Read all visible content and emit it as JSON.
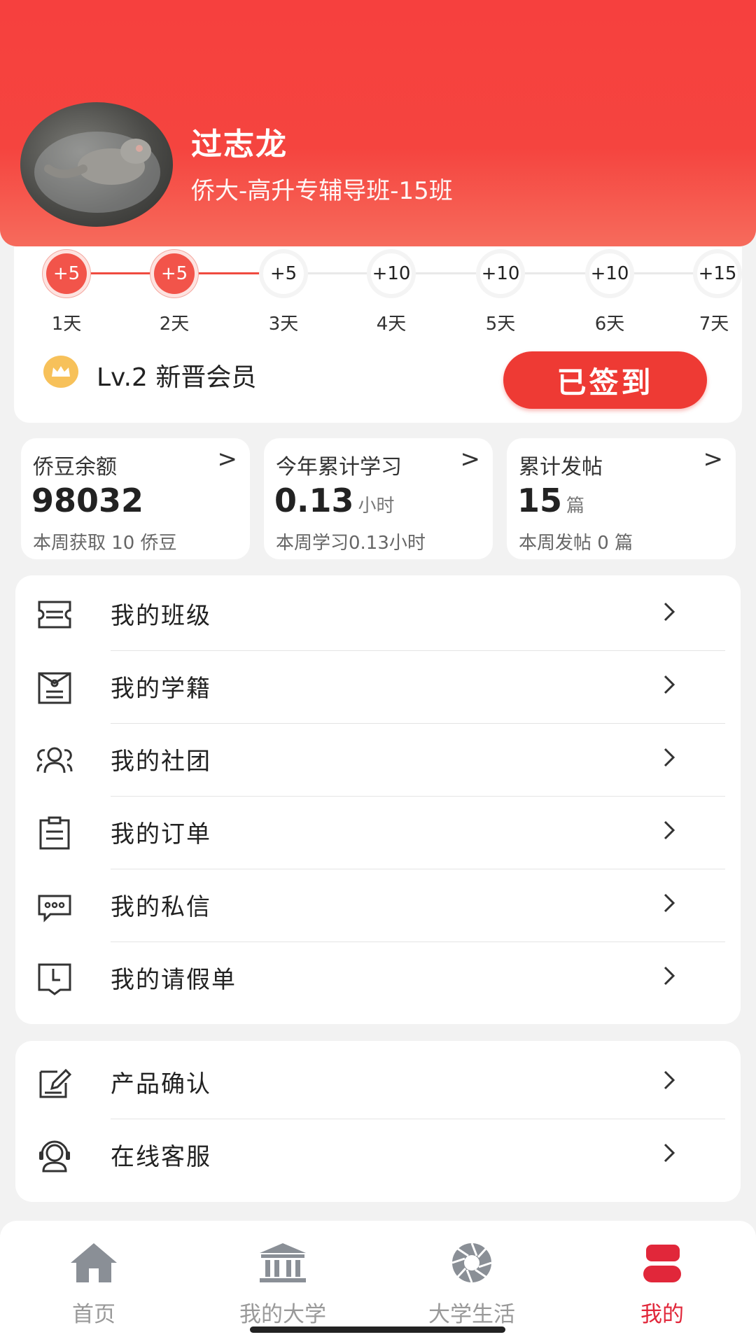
{
  "colors": {
    "accent": "#ee3a34",
    "active_tab": "#e1273a"
  },
  "profile": {
    "name": "过志龙",
    "class_name": "侨大-高升专辅导班-15班"
  },
  "checkin": {
    "days": [
      {
        "points": "+5",
        "label": "1天",
        "done": true
      },
      {
        "points": "+5",
        "label": "2天",
        "done": true
      },
      {
        "points": "+5",
        "label": "3天",
        "done": false
      },
      {
        "points": "+10",
        "label": "4天",
        "done": false
      },
      {
        "points": "+10",
        "label": "5天",
        "done": false
      },
      {
        "points": "+10",
        "label": "6天",
        "done": false
      },
      {
        "points": "+15",
        "label": "7天",
        "done": false
      }
    ],
    "level": "Lv.2 新晋会员",
    "button_label": "已签到"
  },
  "stats": [
    {
      "title": "侨豆余额",
      "value": "98032",
      "unit": "",
      "sub": "本周获取 10 侨豆"
    },
    {
      "title": "今年累计学习",
      "value": "0.13",
      "unit": "小时",
      "sub": "本周学习0.13小时"
    },
    {
      "title": "累计发帖",
      "value": "15",
      "unit": "篇",
      "sub": "本周发帖 0 篇"
    }
  ],
  "menu1": [
    {
      "label": "我的班级",
      "icon": "class-ticket-icon"
    },
    {
      "label": "我的学籍",
      "icon": "student-record-icon"
    },
    {
      "label": "我的社团",
      "icon": "group-icon"
    },
    {
      "label": "我的订单",
      "icon": "clipboard-icon"
    },
    {
      "label": "我的私信",
      "icon": "message-icon"
    },
    {
      "label": "我的请假单",
      "icon": "leave-clock-icon"
    }
  ],
  "menu2": [
    {
      "label": "产品确认",
      "icon": "edit-note-icon"
    },
    {
      "label": "在线客服",
      "icon": "headset-icon"
    }
  ],
  "tabs": [
    {
      "label": "首页",
      "icon": "home-icon",
      "active": false
    },
    {
      "label": "我的大学",
      "icon": "university-icon",
      "active": false
    },
    {
      "label": "大学生活",
      "icon": "aperture-icon",
      "active": false
    },
    {
      "label": "我的",
      "icon": "person-icon",
      "active": true
    }
  ]
}
